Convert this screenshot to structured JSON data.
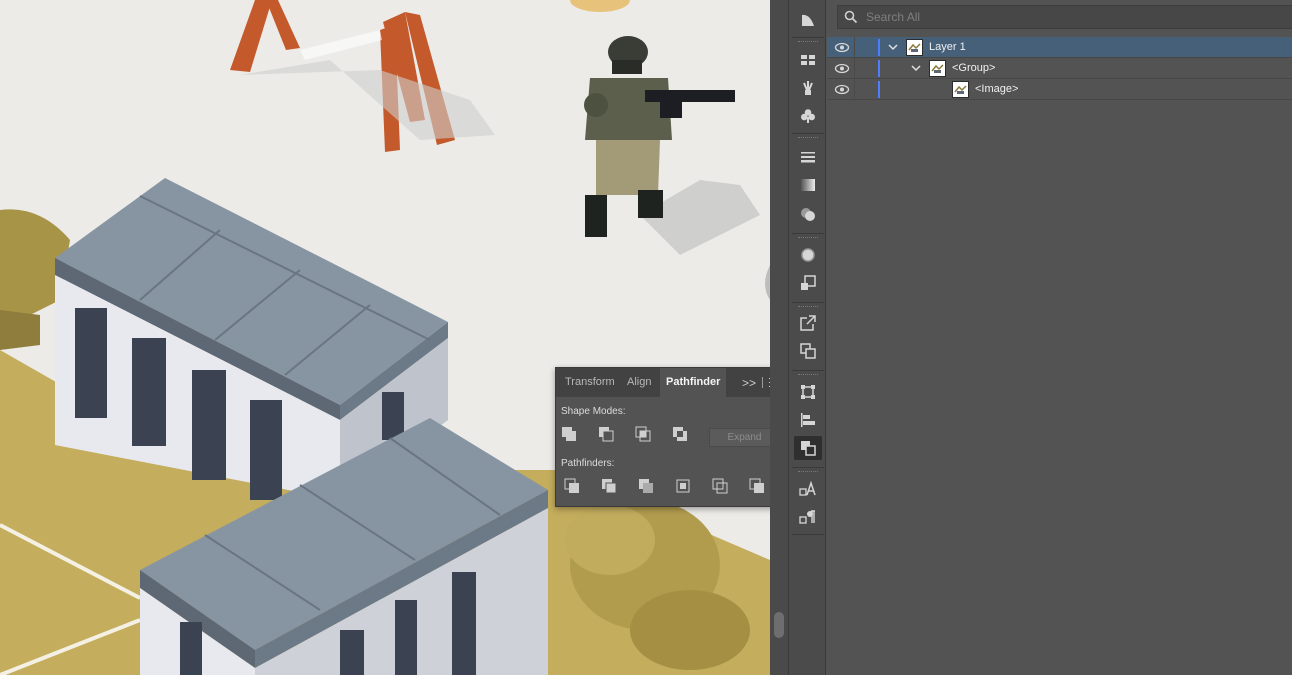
{
  "layers_panel": {
    "search": {
      "placeholder": "Search All",
      "value": ""
    },
    "rows": [
      {
        "name": "Layer 1",
        "visible": true,
        "expanded": true,
        "selected": true,
        "depth": 0
      },
      {
        "name": "<Group>",
        "visible": true,
        "expanded": true,
        "selected": false,
        "depth": 1
      },
      {
        "name": "<Image>",
        "visible": true,
        "expanded": false,
        "selected": false,
        "depth": 2
      }
    ],
    "layer_color": "#4e7dff",
    "selection_color": "#46607a"
  },
  "pathfinder_panel": {
    "tabs": [
      "Transform",
      "Align",
      "Pathfinder"
    ],
    "active_tab": "Pathfinder",
    "overflow_label": ">>",
    "shape_modes_label": "Shape Modes:",
    "shape_modes": [
      "unite-icon",
      "minus-front-icon",
      "intersect-icon",
      "exclude-icon"
    ],
    "expand_label": "Expand",
    "pathfinders_label": "Pathfinders:",
    "pathfinders": [
      "divide-icon",
      "trim-icon",
      "merge-icon",
      "crop-icon",
      "outline-icon",
      "minus-back-icon"
    ]
  },
  "dock": {
    "icons": [
      "shaper-panel-icon",
      "libraries-icon",
      "brushes-icon",
      "symbols-icon",
      "stroke-icon",
      "gradient-icon",
      "transparency-icon",
      "appearance-icon",
      "graphic-styles-icon",
      "export-icon",
      "asset-export-icon",
      "transform-icon",
      "align-icon",
      "pathfinder-icon",
      "character-styles-icon",
      "paragraph-styles-icon"
    ],
    "active": "pathfinder-icon"
  }
}
